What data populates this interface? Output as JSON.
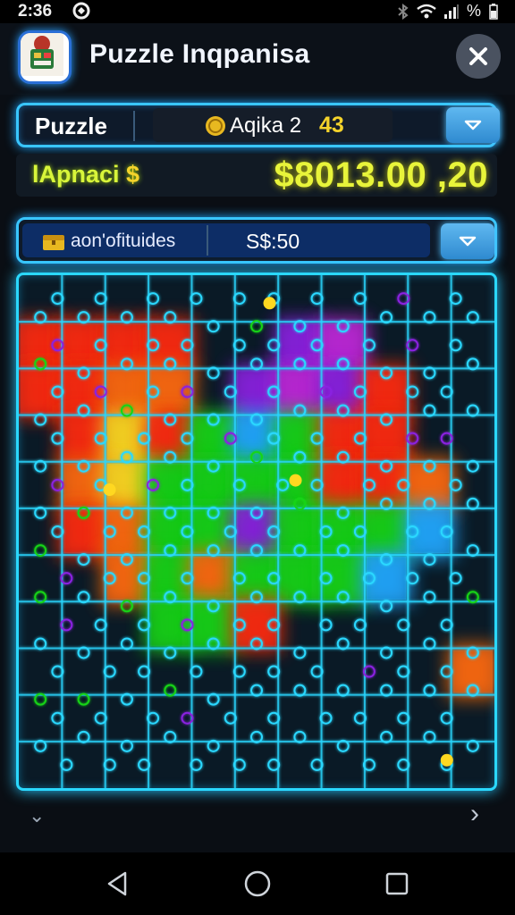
{
  "status_bar": {
    "time": "2:36",
    "battery_text": "%"
  },
  "header": {
    "title": "Puzzle Inqpanisa"
  },
  "top_panel": {
    "mode_label": "Puzzle",
    "player_name": "Aqika 2",
    "player_level": "43"
  },
  "score_row": {
    "label": "lApnaci",
    "label_symbol": "$",
    "value": "$8013.00 ,20"
  },
  "attribute_panel": {
    "label": "aon'ofituides",
    "value": "S$:50"
  },
  "board": {
    "columns": 11,
    "rows": 11,
    "grid_color": "#2ad8ff",
    "colors": {
      "red": "#ff2a10",
      "orange": "#ff6a10",
      "yellow": "#ffd820",
      "green": "#18d418",
      "blue": "#20a8ff",
      "purple": "#8a20e0",
      "magenta": "#c028d8"
    }
  },
  "colors": {
    "accent": "#39c6ff",
    "score": "#e8f43a",
    "level": "#f4d32b"
  },
  "icons": {
    "close": "close-icon",
    "dropdown": "chevron-down-icon",
    "coin": "coin-icon",
    "chest": "chest-icon",
    "back": "back-triangle-icon",
    "home": "home-circle-icon",
    "recents": "recents-square-icon"
  }
}
